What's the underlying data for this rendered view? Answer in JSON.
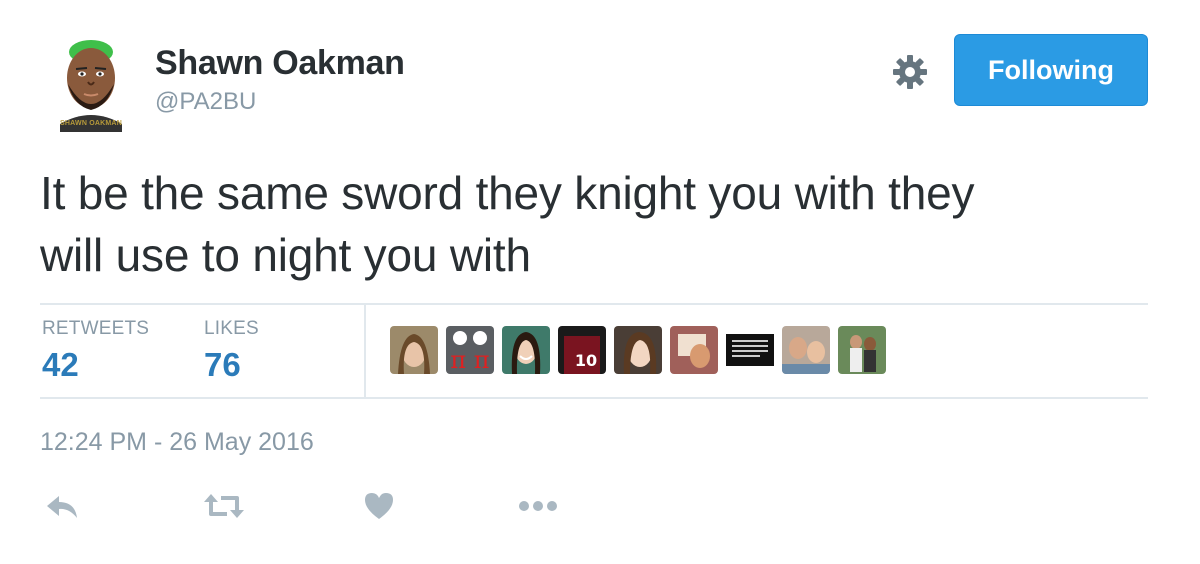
{
  "user": {
    "name": "Shawn Oakman",
    "handle": "@PA2BU",
    "avatar_caption": "SHAWN OAKMAN"
  },
  "follow_button": {
    "label": "Following",
    "color": "#2b9be4"
  },
  "tweet": {
    "text_line1": "It be the same sword they knight you with they",
    "text_line2": "will use to night you with"
  },
  "stats": {
    "retweets_label": "RETWEETS",
    "retweets_count": "42",
    "likes_label": "LIKES",
    "likes_count": "76"
  },
  "likers": [
    {
      "icon": "liker-avatar-1"
    },
    {
      "icon": "liker-avatar-2",
      "text": "π π"
    },
    {
      "icon": "liker-avatar-3"
    },
    {
      "icon": "liker-avatar-4",
      "text": "10"
    },
    {
      "icon": "liker-avatar-5"
    },
    {
      "icon": "liker-avatar-6"
    },
    {
      "icon": "liker-avatar-7"
    },
    {
      "icon": "liker-avatar-8"
    },
    {
      "icon": "liker-avatar-9"
    }
  ],
  "timestamp": "12:24 PM - 26 May 2016",
  "actions": [
    "reply-icon",
    "retweet-icon",
    "like-icon",
    "more-icon"
  ],
  "colors": {
    "text": "#292f33",
    "secondary": "#8899a6",
    "link": "#2b7bb9",
    "divider": "#e1e8ed",
    "action_icons": "#aab8c2"
  }
}
